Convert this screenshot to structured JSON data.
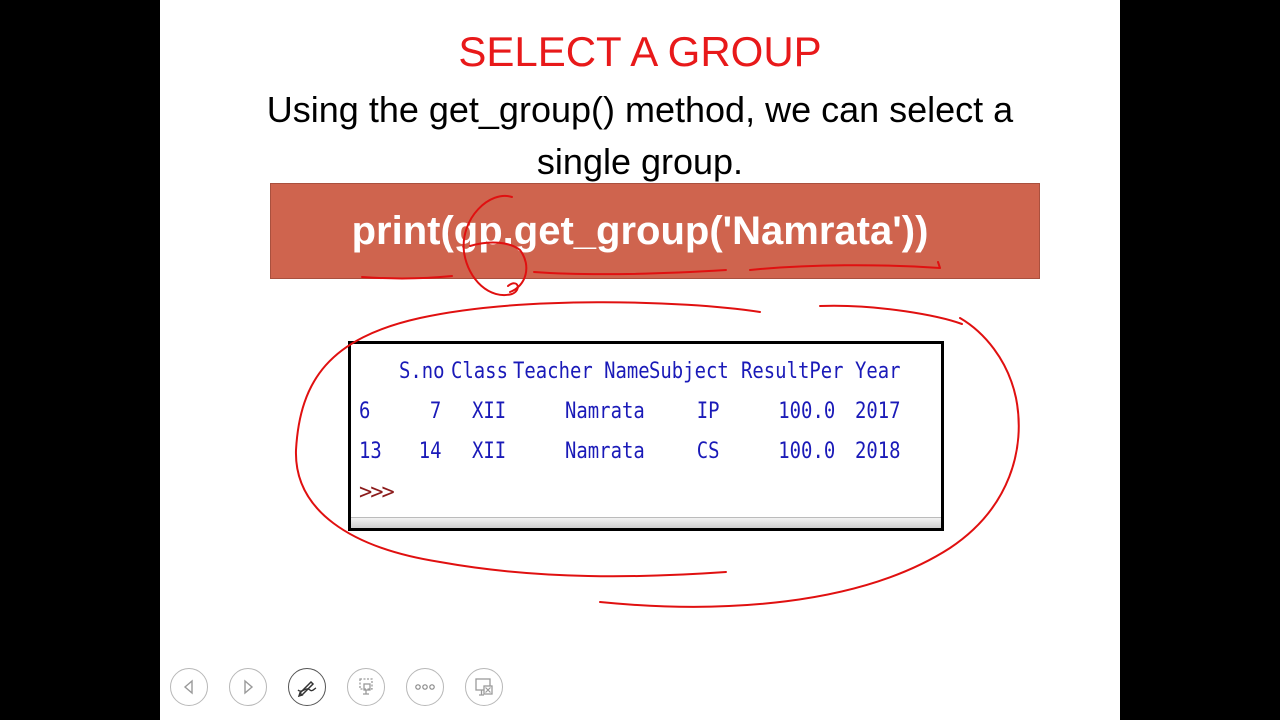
{
  "slide": {
    "title": "SELECT A GROUP",
    "subtitle": "Using the get_group() method, we can select a single group.",
    "code": "print(gp.get_group('Namrata'))"
  },
  "console": {
    "columns": [
      "S.no",
      "Class",
      "Teacher Name",
      "Subject",
      "ResultPer",
      "Year"
    ],
    "rows": [
      {
        "index": "6",
        "cells": [
          "7",
          "XII",
          "Namrata",
          "IP",
          "100.0",
          "2017"
        ]
      },
      {
        "index": "13",
        "cells": [
          "14",
          "XII",
          "Namrata",
          "CS",
          "100.0",
          "2018"
        ]
      }
    ],
    "prompt": ">>>"
  },
  "colors": {
    "title": "#e8191a",
    "banner": "#cf644e",
    "console_text": "#1a1ab8",
    "prompt": "#8b1a1a",
    "annotation_ink": "#e01010"
  },
  "navigation": {
    "buttons": [
      {
        "icon": "previous-slide-icon"
      },
      {
        "icon": "next-slide-icon"
      },
      {
        "icon": "pen-tool-icon"
      },
      {
        "icon": "slide-view-icon"
      },
      {
        "icon": "more-options-icon"
      },
      {
        "icon": "presenter-view-icon"
      }
    ]
  }
}
